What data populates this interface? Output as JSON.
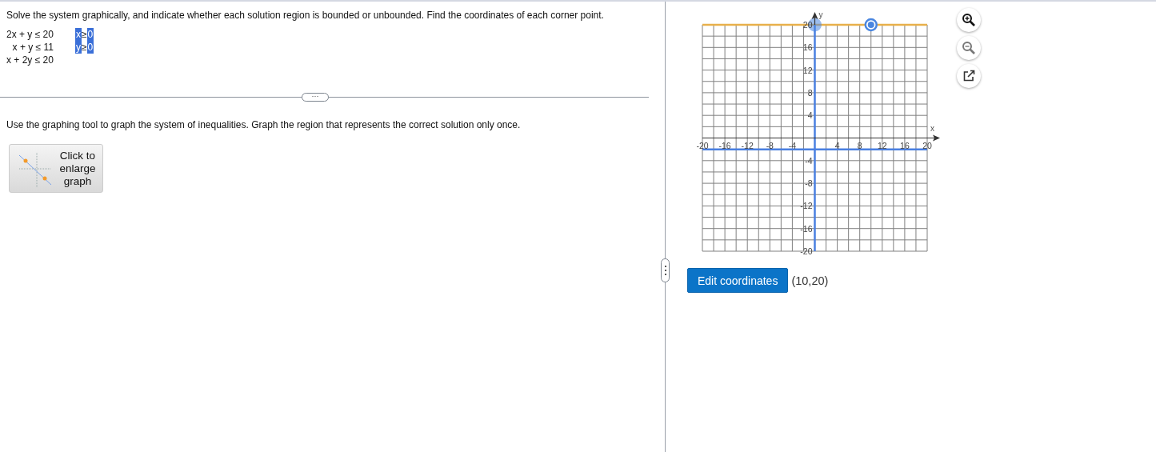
{
  "question": {
    "prompt": "Solve the system graphically, and indicate whether each solution region is bounded or unbounded. Find the coordinates of each corner point.",
    "inequalities": [
      "2x + y ≤ 20",
      "x + y ≤ 11",
      "x + 2y ≤ 20"
    ],
    "constraints": [
      {
        "variable": "x",
        "relation": "≥",
        "value": "0",
        "highlighted": true
      },
      {
        "variable": "y",
        "relation": "≥",
        "value": "0",
        "highlighted": true
      }
    ]
  },
  "divider_handle": "···",
  "instruction": "Use the graphing tool to graph the system of inequalities. Graph the region that represents the correct solution only once.",
  "enlarge_button": {
    "label": "Click to enlarge graph"
  },
  "graph": {
    "chart_data": {
      "type": "line",
      "xlabel": "x",
      "ylabel": "y",
      "xlim": [
        -20,
        20
      ],
      "ylim": [
        -20,
        20
      ],
      "xticks": [
        -20,
        -16,
        -12,
        -8,
        -4,
        4,
        8,
        12,
        16,
        20
      ],
      "yticks": [
        -20,
        -16,
        -12,
        -8,
        -4,
        4,
        8,
        12,
        16,
        20
      ],
      "grid": true,
      "series": [
        {
          "color": "#e8b04b",
          "x": [
            -20,
            20
          ],
          "values": [
            20,
            20
          ]
        },
        {
          "color": "#4a7fe0",
          "x": [
            0,
            0
          ],
          "values": [
            -20,
            20
          ]
        },
        {
          "color": "#4a7fe0",
          "x": [
            -20,
            20
          ],
          "values": [
            -2,
            -2
          ]
        },
        {
          "color": "#4a86e0",
          "marker": "circle",
          "x": [
            0
          ],
          "values": [
            20
          ]
        },
        {
          "color": "#4a86e0",
          "marker": "circle",
          "x": [
            10
          ],
          "values": [
            20
          ]
        }
      ]
    },
    "points": [
      {
        "selected": false
      },
      {
        "selected": true
      }
    ]
  },
  "edit_button": "Edit coordinates",
  "coordinates": "(10,20)"
}
